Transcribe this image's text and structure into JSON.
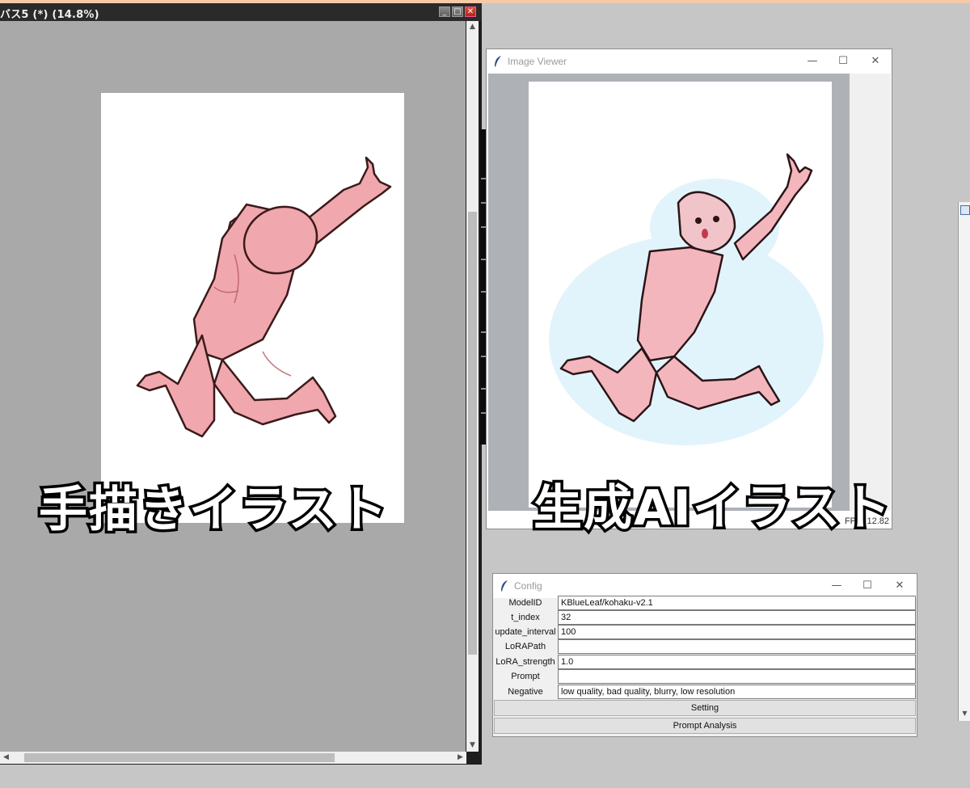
{
  "paint_window": {
    "title": "バス5 (*) (14.8%)",
    "controls": {
      "minimize": "_",
      "maximize": "□",
      "close": "✕"
    }
  },
  "image_viewer": {
    "title": "Image Viewer",
    "fps": "FPS: 12.82",
    "controls": {
      "minimize": "—",
      "maximize": "☐",
      "close": "✕"
    }
  },
  "config": {
    "title": "Config",
    "controls": {
      "minimize": "—",
      "maximize": "☐",
      "close": "✕"
    },
    "fields": [
      {
        "label": "ModelID",
        "value": "KBlueLeaf/kohaku-v2.1"
      },
      {
        "label": "t_index",
        "value": "32"
      },
      {
        "label": "update_interval",
        "value": "100"
      },
      {
        "label": "LoRAPath",
        "value": ""
      },
      {
        "label": "LoRA_strength",
        "value": "1.0"
      },
      {
        "label": "Prompt",
        "value": ""
      },
      {
        "label": "Negative Prompt",
        "value": "low quality, bad quality, blurry, low resolution"
      }
    ],
    "buttons": {
      "setting": "Setting",
      "prompt_analysis": "Prompt Analysis"
    }
  },
  "captions": {
    "left": "手描きイラスト",
    "right": "生成AIイラスト"
  },
  "colors": {
    "skin": "#f0a7ad",
    "outline": "#3a1a1a",
    "desktop": "#c6c6c6",
    "canvas_bg": "#a9a9a9"
  }
}
